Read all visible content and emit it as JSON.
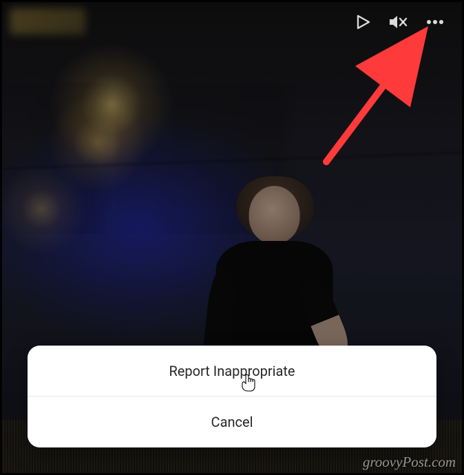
{
  "icons": {
    "play": "play-icon",
    "muted": "muted-icon",
    "more": "more-options-icon"
  },
  "action_sheet": {
    "report_label": "Report Inappropriate",
    "cancel_label": "Cancel"
  },
  "watermark": "groovyPost.com",
  "annotation": {
    "arrow_color": "#ff3a3a"
  }
}
